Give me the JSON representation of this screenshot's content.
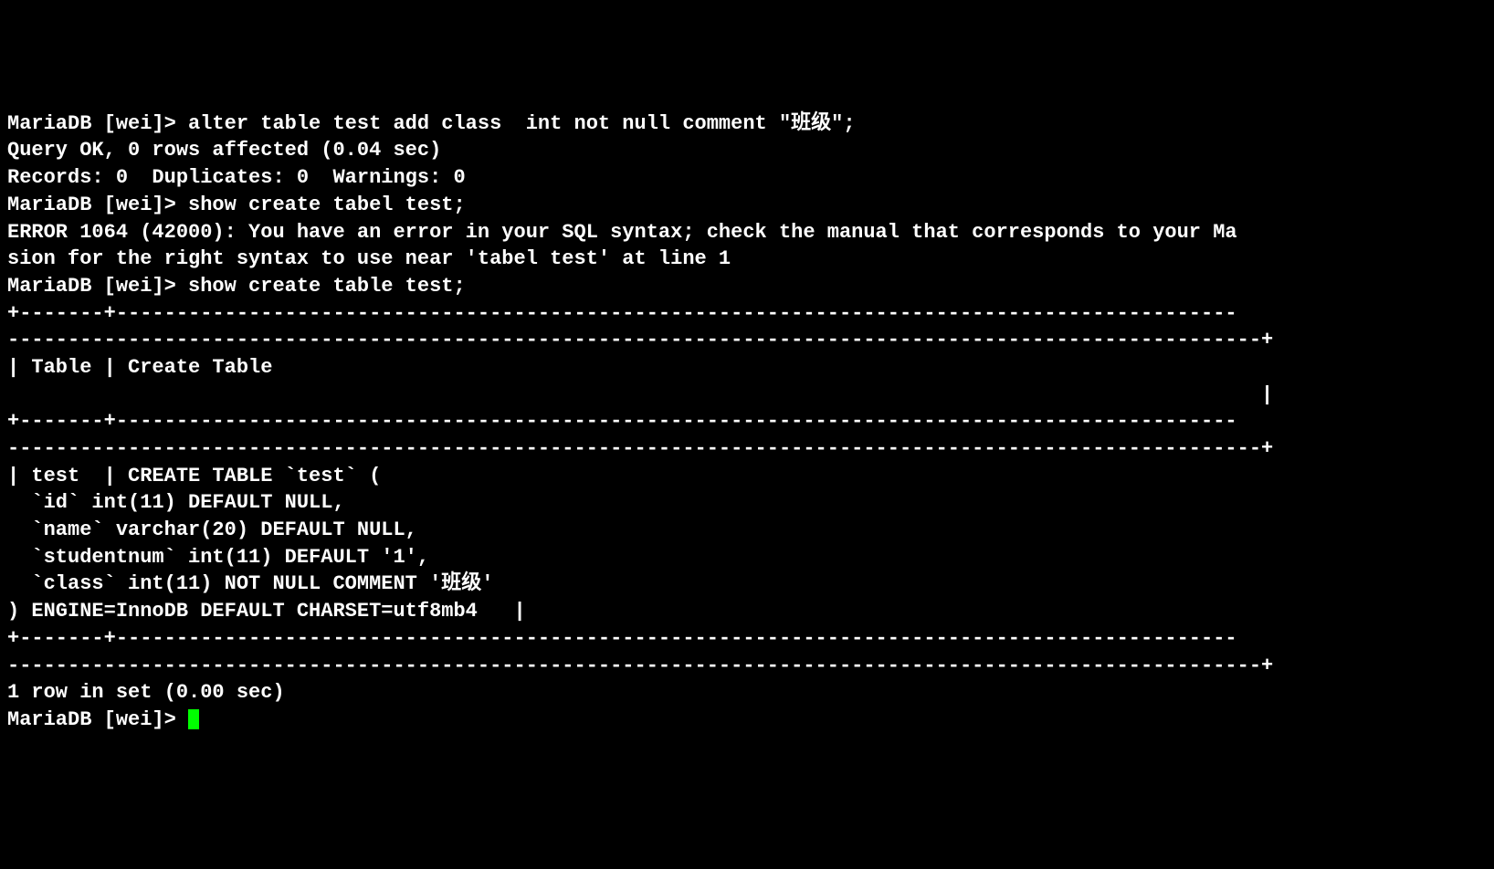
{
  "terminal": {
    "lines": [
      "MariaDB [wei]> alter table test add class  int not null comment \"班级\";",
      "Query OK, 0 rows affected (0.04 sec)",
      "Records: 0  Duplicates: 0  Warnings: 0",
      "",
      "MariaDB [wei]> show create tabel test;",
      "ERROR 1064 (42000): You have an error in your SQL syntax; check the manual that corresponds to your Ma",
      "sion for the right syntax to use near 'tabel test' at line 1",
      "MariaDB [wei]> show create table test;",
      "+-------+---------------------------------------------------------------------------------------------",
      "--------------------------------------------------------------------------------------------------------+",
      "| Table | Create Table                                                                                  ",
      "                                                                                                        |",
      "+-------+---------------------------------------------------------------------------------------------",
      "--------------------------------------------------------------------------------------------------------+",
      "| test  | CREATE TABLE `test` (",
      "  `id` int(11) DEFAULT NULL,",
      "  `name` varchar(20) DEFAULT NULL,",
      "  `studentnum` int(11) DEFAULT '1',",
      "  `class` int(11) NOT NULL COMMENT '班级'",
      ") ENGINE=InnoDB DEFAULT CHARSET=utf8mb4   |",
      "+-------+---------------------------------------------------------------------------------------------",
      "--------------------------------------------------------------------------------------------------------+",
      "1 row in set (0.00 sec)",
      ""
    ],
    "prompt_partial": "MariaDB [wei]> "
  }
}
